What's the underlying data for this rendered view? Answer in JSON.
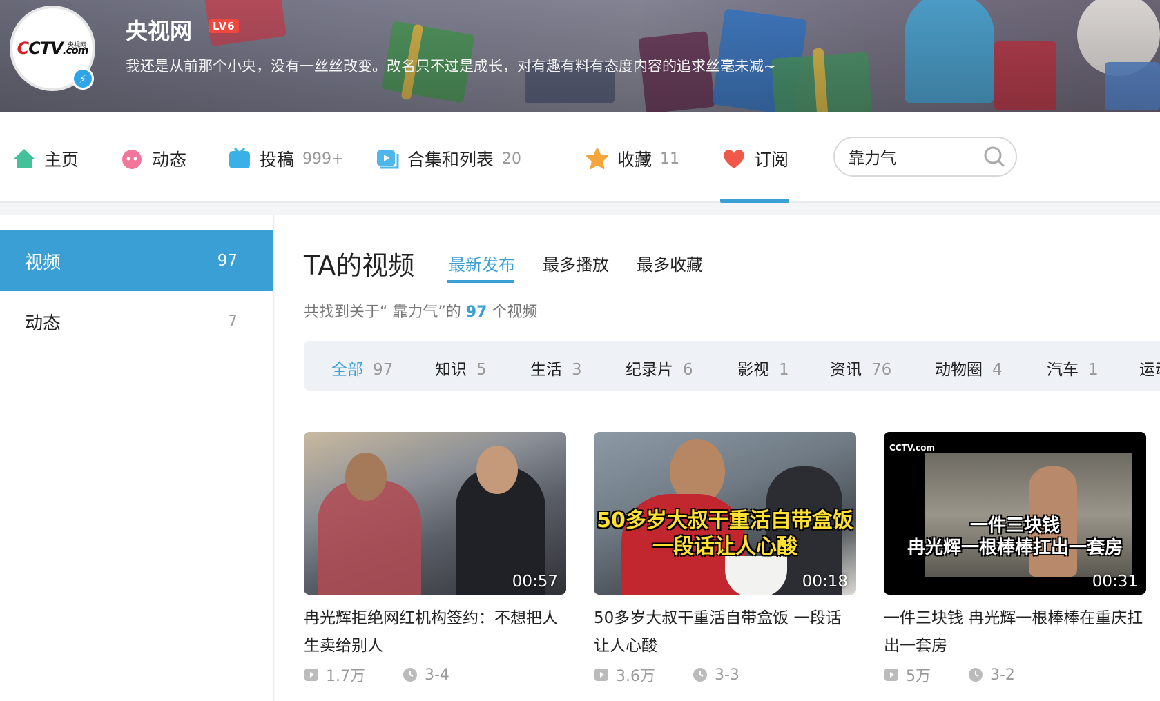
{
  "header": {
    "username": "央视网",
    "level": "LV6",
    "signature": "我还是从前那个小央，没有一丝丝改变。改名只不过是成长，对有趣有料有态度内容的追求丝毫未减~",
    "avatar_text": "CCTV.com",
    "avatar_sub": "央视网"
  },
  "nav": {
    "items": [
      {
        "label": "主页",
        "count": ""
      },
      {
        "label": "动态",
        "count": ""
      },
      {
        "label": "投稿",
        "count": "999+"
      },
      {
        "label": "合集和列表",
        "count": "20"
      },
      {
        "label": "收藏",
        "count": "11"
      },
      {
        "label": "订阅",
        "count": ""
      }
    ],
    "search_value": "靠力气"
  },
  "sidebar": {
    "items": [
      {
        "label": "视频",
        "count": "97"
      },
      {
        "label": "动态",
        "count": "7"
      }
    ]
  },
  "main": {
    "title": "TA的视频",
    "sort_tabs": [
      "最新发布",
      "最多播放",
      "最多收藏"
    ],
    "found_prefix": "共找到关于“ 靠力气”的",
    "found_count": "97",
    "found_suffix": "个视频",
    "categories": [
      {
        "label": "全部",
        "count": "97"
      },
      {
        "label": "知识",
        "count": "5"
      },
      {
        "label": "生活",
        "count": "3"
      },
      {
        "label": "纪录片",
        "count": "6"
      },
      {
        "label": "影视",
        "count": "1"
      },
      {
        "label": "资讯",
        "count": "76"
      },
      {
        "label": "动物圈",
        "count": "4"
      },
      {
        "label": "汽车",
        "count": "1"
      },
      {
        "label": "运动",
        "count": ""
      }
    ],
    "videos": [
      {
        "title": "冉光辉拒绝网红机构签约：不想把人生卖给别人",
        "duration": "00:57",
        "plays": "1.7万",
        "date": "3-4",
        "overlay": ""
      },
      {
        "title": "50多岁大叔干重活自带盒饭 一段话让人心酸",
        "duration": "00:18",
        "plays": "3.6万",
        "date": "3-3",
        "overlay": "50多岁大叔干重活自带盒饭\n一段话让人心酸"
      },
      {
        "title": "一件三块钱 冉光辉一根棒棒在重庆扛出一套房",
        "duration": "00:31",
        "plays": "5万",
        "date": "3-2",
        "overlay": "一件三块钱\n冉光辉一根棒棒扛出一套房"
      }
    ]
  },
  "colors": {
    "accent": "#3a9fd5",
    "level_badge": "#f0473f"
  }
}
